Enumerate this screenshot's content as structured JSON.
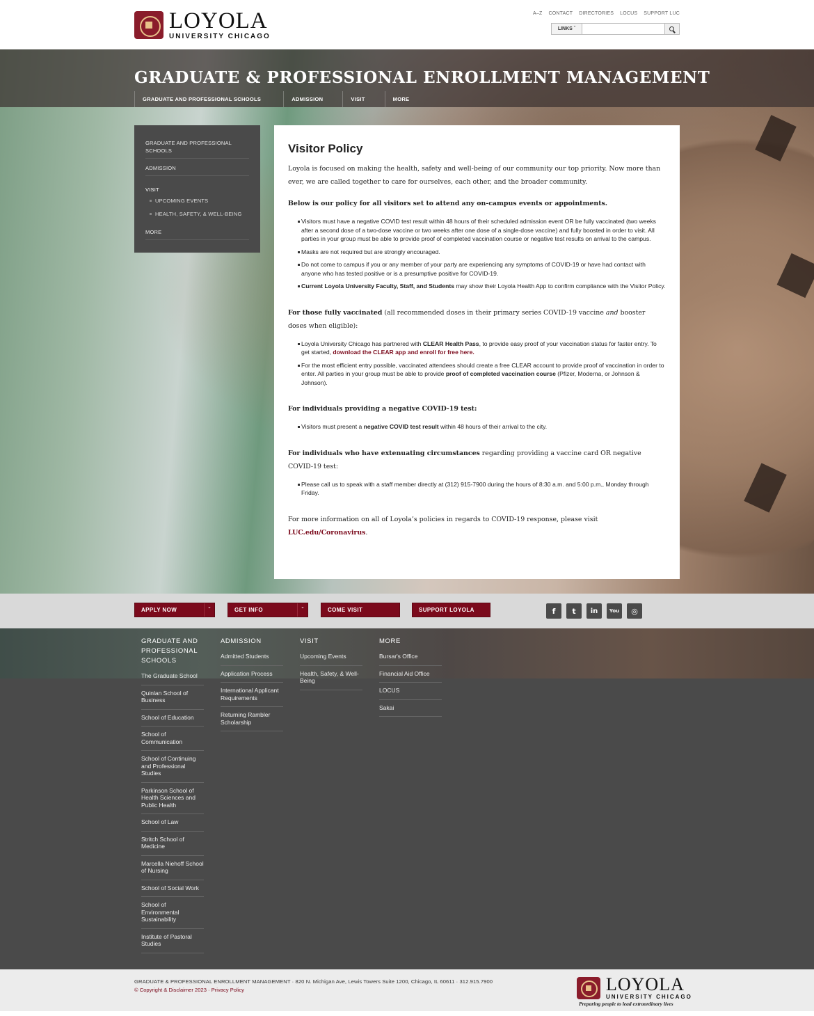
{
  "header": {
    "logo_main": "LOYOLA",
    "logo_sub": "UNIVERSITY CHICAGO",
    "utility_links": [
      "A–Z",
      "CONTACT",
      "DIRECTORIES",
      "LOCUS",
      "SUPPORT LUC"
    ],
    "links_button": "LINKS ˇ",
    "search_placeholder": ""
  },
  "hero": {
    "site_title": "GRADUATE & PROFESSIONAL ENROLLMENT MANAGEMENT",
    "nav": [
      "GRADUATE AND PROFESSIONAL SCHOOLS",
      "ADMISSION",
      "VISIT",
      "MORE"
    ]
  },
  "sidebar": {
    "items": [
      "GRADUATE AND PROFESSIONAL SCHOOLS",
      "ADMISSION",
      "VISIT",
      "MORE"
    ],
    "subitems": [
      "UPCOMING EVENTS",
      "HEALTH, SAFETY, & WELL-BEING"
    ]
  },
  "content": {
    "title": "Visitor Policy",
    "intro": "Loyola is focused on making the health, safety and well-being of our community our top priority. Now more than ever, we are called together to care for ourselves, each other, and the broader community.",
    "lead": "Below is our policy for all visitors set to attend any on-campus events or appointments.",
    "policy_items": [
      "Visitors must have a negative COVID test result within 48 hours of their scheduled admission event OR be fully vaccinated (two weeks after a second dose of a two-dose vaccine or two weeks after one dose of a single-dose vaccine) and fully boosted in order to visit. All parties in your group must be able to provide proof of completed vaccination course or negative test results on arrival to the campus.",
      "Masks are not required but are strongly encouraged.",
      "Do not come to campus if you or any member of your party are experiencing any symptoms of COVID-19 or have had contact with anyone who has tested positive or is a presumptive positive for COVID-19."
    ],
    "faculty_bold": "Current Loyola University Faculty, Staff, and Students",
    "faculty_rest": " may show their Loyola Health App to confirm compliance with the Visitor Policy.",
    "vacc_heading_bold": "For those fully vaccinated",
    "vacc_heading_rest1": " (all recommended doses in their primary series COVID-19 vaccine ",
    "vacc_heading_italic": "and",
    "vacc_heading_rest2": " booster doses when eligible):",
    "clear_1": "Loyola University Chicago has partnered with ",
    "clear_bold": "CLEAR Health Pass",
    "clear_2": ", to provide easy proof of your vaccination status for faster entry. To get started, ",
    "clear_link": "download the CLEAR app and enroll for free here.",
    "entry_1": "For the most efficient entry possible, vaccinated attendees should create a free CLEAR account to provide proof of vaccination in order to enter. All parties in your group must be able to provide ",
    "entry_bold": "proof of completed vaccination course",
    "entry_2": " (Pfizer, Moderna, or Johnson & Johnson).",
    "neg_heading": "For individuals providing a negative COVID-19 test:",
    "neg_1": "Visitors must present a ",
    "neg_bold": "negative COVID test result",
    "neg_2": " within 48 hours of their arrival to the city.",
    "ext_heading_bold": "For individuals who have extenuating circumstances",
    "ext_heading_rest": " regarding providing a vaccine card OR negative COVID-19 test:",
    "ext_item": "Please call us to speak with a staff member directly at (312) 915-7900 during the hours of 8:30 a.m. and 5:00 p.m., Monday through Friday.",
    "more_info": "For more information on all of Loyola’s policies in regards to COVID-19 response, please visit ",
    "more_link": "LUC.edu/Coronavirus",
    "more_end": "."
  },
  "cta": {
    "apply": "APPLY NOW",
    "info": "GET INFO",
    "visit": "COME VISIT",
    "support": "SUPPORT LOYOLA",
    "dropdown": "ˇ"
  },
  "social": {
    "facebook": "f",
    "twitter": "t",
    "linkedin": "in",
    "youtube": "You",
    "instagram": "◎"
  },
  "footer": {
    "col1": {
      "heading": "GRADUATE AND PROFESSIONAL SCHOOLS",
      "links": [
        "The Graduate School",
        "Quinlan School of Business",
        "School of Education",
        "School of Communication",
        "School of Continuing and Professional Studies",
        "Parkinson School of Health Sciences and Public Health",
        "School of Law",
        "Stritch School of Medicine",
        "Marcella Niehoff School of Nursing",
        "School of Social Work",
        "School of Environmental Sustainability",
        "Institute of Pastoral Studies"
      ]
    },
    "col2": {
      "heading": "ADMISSION",
      "links": [
        "Admitted Students",
        "Application Process",
        "International Applicant Requirements",
        "Returning Rambler Scholarship"
      ]
    },
    "col3": {
      "heading": "VISIT",
      "links": [
        "Upcoming Events",
        "Health, Safety, & Well-Being"
      ]
    },
    "col4": {
      "heading": "MORE",
      "links": [
        "Bursar's Office",
        "Financial Aid Office",
        "LOCUS",
        "Sakai"
      ]
    }
  },
  "bottom": {
    "address": "GRADUATE & PROFESSIONAL ENROLLMENT MANAGEMENT · 820 N. Michigan Ave, Lewis Towers Suite 1200, Chicago, IL 60611 · 312.915.7900",
    "copyright": "© Copyright & Disclaimer 2023",
    "privacy": "Privacy Policy",
    "sep": " · ",
    "tagline": "Preparing people to lead extraordinary lives"
  },
  "colors": {
    "maroon": "#7b0a1c",
    "sidebar": "#4a4a4a",
    "cta_bar": "#d9d9d9"
  }
}
